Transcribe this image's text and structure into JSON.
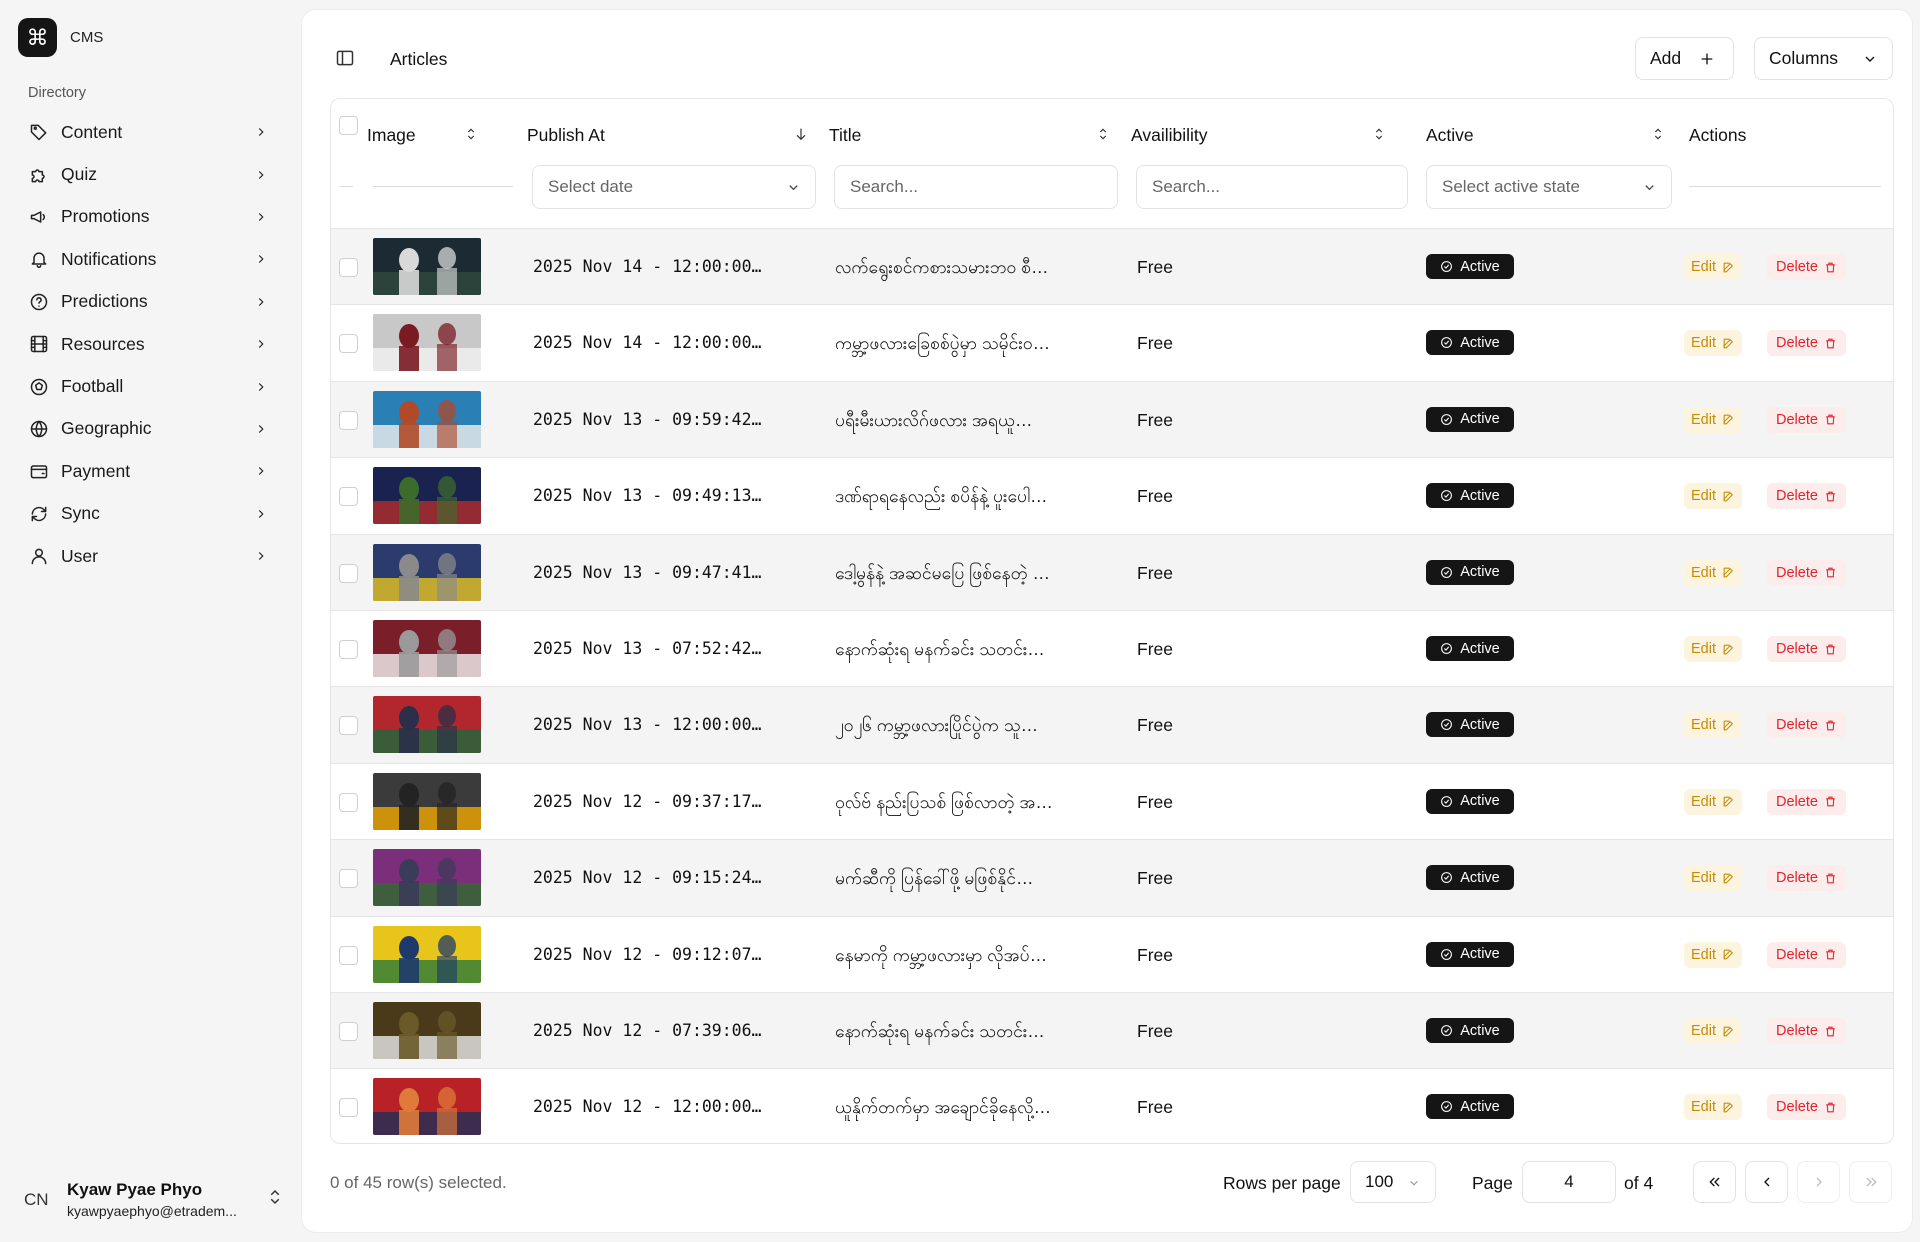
{
  "brand": {
    "name": "CMS",
    "logo_icon": "command-icon"
  },
  "sidebar": {
    "section_label": "Directory",
    "items": [
      {
        "label": "Content",
        "icon": "tag-icon"
      },
      {
        "label": "Quiz",
        "icon": "puzzle-icon"
      },
      {
        "label": "Promotions",
        "icon": "megaphone-icon"
      },
      {
        "label": "Notifications",
        "icon": "bell-icon"
      },
      {
        "label": "Predictions",
        "icon": "help-circle-icon"
      },
      {
        "label": "Resources",
        "icon": "film-icon"
      },
      {
        "label": "Football",
        "icon": "football-icon"
      },
      {
        "label": "Geographic",
        "icon": "globe-icon"
      },
      {
        "label": "Payment",
        "icon": "wallet-icon"
      },
      {
        "label": "Sync",
        "icon": "refresh-icon"
      },
      {
        "label": "User",
        "icon": "user-icon"
      }
    ]
  },
  "user": {
    "initials": "CN",
    "name": "Kyaw Pyae Phyo",
    "email": "kyawpyaephyo@etradem..."
  },
  "header": {
    "title": "Articles",
    "add_label": "Add",
    "columns_label": "Columns"
  },
  "table": {
    "columns": {
      "image": "Image",
      "publish_at": "Publish At",
      "title": "Title",
      "availability": "Availibility",
      "active": "Active",
      "actions": "Actions"
    },
    "filters": {
      "publish_at": "Select date",
      "title": "Search...",
      "availability": "Search...",
      "active": "Select active state"
    },
    "badge_label": "Active",
    "edit_label": "Edit",
    "delete_label": "Delete",
    "rows": [
      {
        "date": "2025 Nov 14 - 12:00:00…",
        "title": "လက်ရွေးစင်ကစားသမားဘဝ စီ…",
        "availability": "Free",
        "active": "Active",
        "thumb_colors": [
          "#1c2a33",
          "#2f4a3c",
          "#d9d9d9"
        ]
      },
      {
        "date": "2025 Nov 14 - 12:00:00…",
        "title": "ကမ္ဘာ့ဖလားခြေစစ်ပွဲမှာ သမိုင်းဝ…",
        "availability": "Free",
        "active": "Active",
        "thumb_colors": [
          "#c8c8c8",
          "#f2f2f2",
          "#7a1a22"
        ]
      },
      {
        "date": "2025 Nov 13 - 09:59:42…",
        "title": "ပရီးမီးယားလိဂ်ဖလား အရယူ…",
        "availability": "Free",
        "active": "Active",
        "thumb_colors": [
          "#2a7fb5",
          "#f0f0f0",
          "#b24a2a"
        ]
      },
      {
        "date": "2025 Nov 13 - 09:49:13…",
        "title": "ဒဏ်ရာရနေလည်း စပိန်နဲ့ ပူးပေါ…",
        "availability": "Free",
        "active": "Active",
        "thumb_colors": [
          "#1a2350",
          "#b32d2a",
          "#3d6b2c"
        ]
      },
      {
        "date": "2025 Nov 13 - 09:47:41…",
        "title": "ဒေါ့မွန်နဲ့ အဆင်မပြေ ဖြစ်နေတဲ့ …",
        "availability": "Free",
        "active": "Active",
        "thumb_colors": [
          "#2b3b6e",
          "#e6c422",
          "#8a8a8a"
        ]
      },
      {
        "date": "2025 Nov 13 - 07:52:42…",
        "title": "နောက်ဆုံးရ မနက်ခင်း သတင်း…",
        "availability": "Free",
        "active": "Active",
        "thumb_colors": [
          "#7a1f2a",
          "#f2f2f2",
          "#9a9a9a"
        ]
      },
      {
        "date": "2025 Nov 13 - 12:00:00…",
        "title": "၂၀၂၆ ကမ္ဘာ့ဖလားပြိုင်ပွဲက သူ…",
        "availability": "Free",
        "active": "Active",
        "thumb_colors": [
          "#b2272d",
          "#1d6a3b",
          "#2b2f4a"
        ]
      },
      {
        "date": "2025 Nov 12 - 09:37:17…",
        "title": "ဝုလ်ဗ် နည်းပြသစ် ဖြစ်လာတဲ့ အ…",
        "availability": "Free",
        "active": "Active",
        "thumb_colors": [
          "#3b3b3b",
          "#f2a900",
          "#232323"
        ]
      },
      {
        "date": "2025 Nov 12 - 09:15:24…",
        "title": "မက်ဆီကို ပြန်ခေါ်ဖို့ မဖြစ်နိုင်…",
        "availability": "Free",
        "active": "Active",
        "thumb_colors": [
          "#7b2f7a",
          "#2f6a2f",
          "#3b3b5a"
        ]
      },
      {
        "date": "2025 Nov 12 - 09:12:07…",
        "title": "နေမာကို ကမ္ဘာ့ဖလားမှာ လိုအပ်…",
        "availability": "Free",
        "active": "Active",
        "thumb_colors": [
          "#e8c51a",
          "#2c7a3a",
          "#1f3a6a"
        ]
      },
      {
        "date": "2025 Nov 12 - 07:39:06…",
        "title": "နောက်ဆုံးရ မနက်ခင်း သတင်း…",
        "availability": "Free",
        "active": "Active",
        "thumb_colors": [
          "#4a3a1a",
          "#e8e8e8",
          "#6a5a2a"
        ]
      },
      {
        "date": "2025 Nov 12 - 12:00:00…",
        "title": "ယူနိုက်တက်မှာ အချောင်ခိုနေလို့…",
        "availability": "Free",
        "active": "Active",
        "thumb_colors": [
          "#b82226",
          "#1f2f5a",
          "#e07a3a"
        ]
      }
    ]
  },
  "footer": {
    "selected_text": "0 of 45 row(s) selected.",
    "rows_per_page_label": "Rows per page",
    "rows_per_page_value": "100",
    "page_label": "Page",
    "page_value": "4",
    "of_label": "of 4"
  }
}
